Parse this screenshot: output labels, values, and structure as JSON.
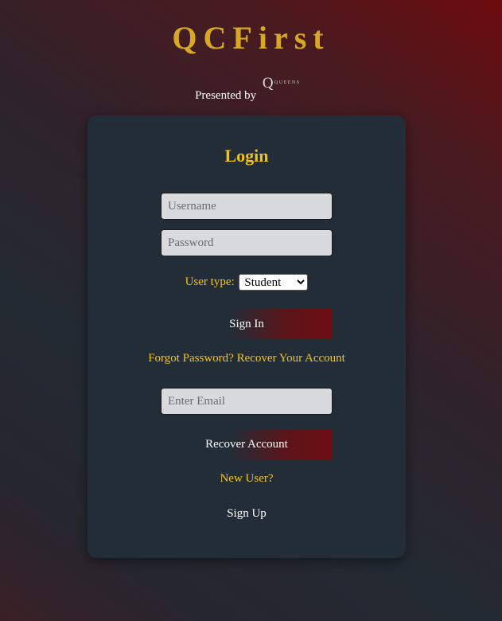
{
  "header": {
    "title": "QCFirst",
    "presented_by": "Presented by",
    "logo_letter": "Q",
    "logo_text": "QUEENS"
  },
  "login": {
    "title": "Login",
    "username_placeholder": "Username",
    "password_placeholder": "Password",
    "user_type_label": "User type:",
    "user_type_selected": "Student",
    "sign_in_label": "Sign In"
  },
  "recover": {
    "prompt": "Forgot Password? Recover Your Account",
    "email_placeholder": "Enter Email",
    "button_label": "Recover Account"
  },
  "signup": {
    "prompt": "New User?",
    "label": "Sign Up"
  },
  "colors": {
    "title_gold": "#d8a823",
    "accent_yellow": "#f2c417",
    "card_bg": "#232d38",
    "button_red": "#6f0e10"
  }
}
